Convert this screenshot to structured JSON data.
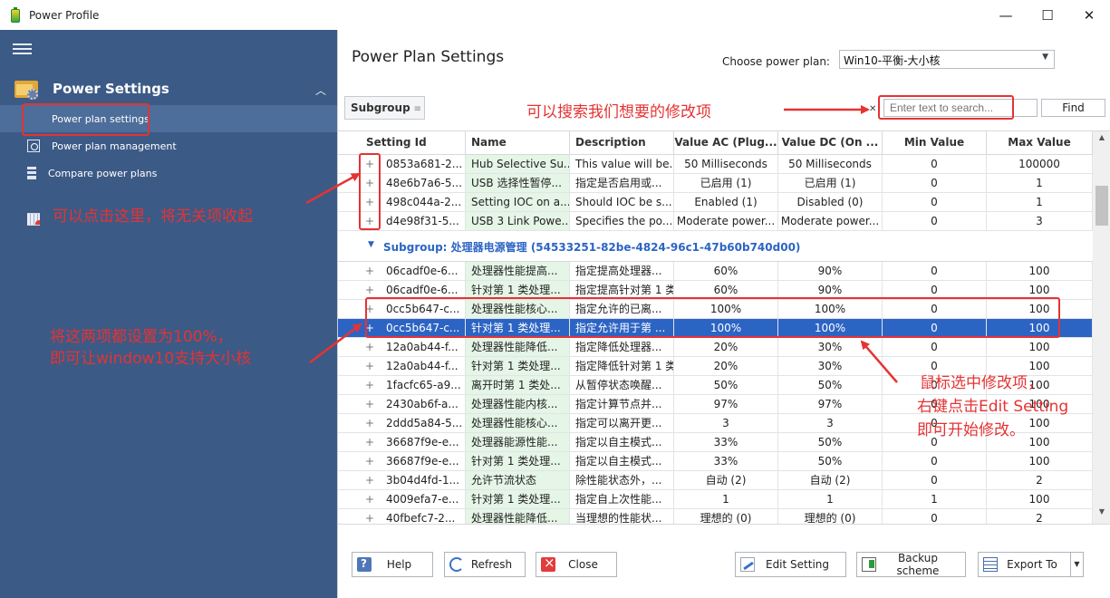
{
  "window": {
    "title": "Power Profile",
    "controls": {
      "minimize": "—",
      "maximize": "☐",
      "close": "✕"
    }
  },
  "sidebar": {
    "header": "Power Settings",
    "items": [
      {
        "label": "Power plan settings",
        "icon": "power-plan-settings-icon",
        "active": true
      },
      {
        "label": "Power plan management",
        "icon": "power-plan-management-icon",
        "active": false
      },
      {
        "label": "Compare power plans",
        "icon": "compare-power-plans-icon",
        "active": false
      }
    ]
  },
  "main": {
    "title": "Power Plan Settings",
    "plan_label": "Choose power plan:",
    "plan_value": "Win10-平衡-大小核",
    "subgroup_button": "Subgroup",
    "search_placeholder": "Enter text to search...",
    "find_button": "Find"
  },
  "grid": {
    "columns": [
      "Setting Id",
      "Name",
      "Description",
      "Value AC (Plug...",
      "Value DC (On ...",
      "Min Value",
      "Max Value"
    ],
    "group1_rows": [
      {
        "expander": "+",
        "id": "0853a681-2...",
        "name": "Hub Selective Su...",
        "desc": "This value will be...",
        "ac": "50 Milliseconds",
        "dc": "50 Milliseconds",
        "min": "0",
        "max": "100000"
      },
      {
        "expander": "+",
        "id": "48e6b7a6-5...",
        "name": "USB 选择性暂停...",
        "desc": "指定是否启用或...",
        "ac": "已启用 (1)",
        "dc": "已启用 (1)",
        "min": "0",
        "max": "1"
      },
      {
        "expander": "+",
        "id": "498c044a-2...",
        "name": "Setting IOC on a...",
        "desc": "Should IOC be s...",
        "ac": "Enabled (1)",
        "dc": "Disabled (0)",
        "min": "0",
        "max": "1"
      },
      {
        "expander": "+",
        "id": "d4e98f31-5...",
        "name": "USB 3 Link Powe...",
        "desc": "Specifies the po...",
        "ac": "Moderate power...",
        "dc": "Moderate power...",
        "min": "0",
        "max": "3"
      }
    ],
    "subgroup_label": "Subgroup: 处理器电源管理 (54533251-82be-4824-96c1-47b60b740d00)",
    "group2_rows": [
      {
        "expander": "+",
        "id": "06cadf0e-6...",
        "name": "处理器性能提高...",
        "desc": "指定提高处理器...",
        "ac": "60%",
        "dc": "90%",
        "min": "0",
        "max": "100"
      },
      {
        "expander": "+",
        "id": "06cadf0e-6...",
        "name": "针对第 1 类处理...",
        "desc": "指定提高针对第 1 类...",
        "ac": "60%",
        "dc": "90%",
        "min": "0",
        "max": "100"
      },
      {
        "expander": "+",
        "id": "0cc5b647-c...",
        "name": "处理器性能核心...",
        "desc": "指定允许的已离...",
        "ac": "100%",
        "dc": "100%",
        "min": "0",
        "max": "100"
      },
      {
        "expander": "+",
        "id": "0cc5b647-c...",
        "name": "针对第 1 类处理...",
        "desc": "指定允许用于第 ...",
        "ac": "100%",
        "dc": "100%",
        "min": "0",
        "max": "100",
        "selected": true
      },
      {
        "expander": "+",
        "id": "12a0ab44-f...",
        "name": "处理器性能降低...",
        "desc": "指定降低处理器...",
        "ac": "20%",
        "dc": "30%",
        "min": "0",
        "max": "100"
      },
      {
        "expander": "+",
        "id": "12a0ab44-f...",
        "name": "针对第 1 类处理...",
        "desc": "指定降低针对第 1 类...",
        "ac": "20%",
        "dc": "30%",
        "min": "0",
        "max": "100"
      },
      {
        "expander": "+",
        "id": "1facfc65-a9...",
        "name": "离开时第 1 类处...",
        "desc": "从暂停状态唤醒...",
        "ac": "50%",
        "dc": "50%",
        "min": "0",
        "max": "100"
      },
      {
        "expander": "+",
        "id": "2430ab6f-a...",
        "name": "处理器性能内核...",
        "desc": "指定计算节点并...",
        "ac": "97%",
        "dc": "97%",
        "min": "0",
        "max": "100"
      },
      {
        "expander": "+",
        "id": "2ddd5a84-5...",
        "name": "处理器性能核心...",
        "desc": "指定可以离开更...",
        "ac": "3",
        "dc": "3",
        "min": "0",
        "max": "100"
      },
      {
        "expander": "+",
        "id": "36687f9e-e...",
        "name": "处理器能源性能...",
        "desc": "指定以自主模式...",
        "ac": "33%",
        "dc": "50%",
        "min": "0",
        "max": "100"
      },
      {
        "expander": "+",
        "id": "36687f9e-e...",
        "name": "针对第 1 类处理...",
        "desc": "指定以自主模式...",
        "ac": "33%",
        "dc": "50%",
        "min": "0",
        "max": "100"
      },
      {
        "expander": "+",
        "id": "3b04d4fd-1...",
        "name": "允许节流状态",
        "desc": "除性能状态外，...",
        "ac": "自动 (2)",
        "dc": "自动 (2)",
        "min": "0",
        "max": "2"
      },
      {
        "expander": "+",
        "id": "4009efa7-e...",
        "name": "针对第 1 类处理...",
        "desc": "指定自上次性能...",
        "ac": "1",
        "dc": "1",
        "min": "1",
        "max": "100"
      },
      {
        "expander": "+",
        "id": "40fbefc7-2...",
        "name": "处理器性能降低...",
        "desc": "当理想的性能状...",
        "ac": "理想的 (0)",
        "dc": "理想的 (0)",
        "min": "0",
        "max": "2"
      }
    ]
  },
  "buttons": {
    "help": "Help",
    "refresh": "Refresh",
    "close": "Close",
    "edit_setting": "Edit Setting",
    "backup_scheme": "Backup scheme",
    "export_to": "Export To"
  },
  "annotations": {
    "search_hint": "可以搜索我们想要的修改项",
    "collapse_hint": "可以点击这里，将无关项收起",
    "set100_line1": "将这两项都设置为100%，",
    "set100_line2": "即可让window10支持大小核",
    "edit_line1": "鼠标选中修改项，",
    "edit_line2": "右键点击Edit Setting",
    "edit_line3": "即可开始修改。"
  },
  "colors": {
    "sidebar_bg": "#3c5a86",
    "selected_row": "#2c64c4",
    "name_cell_bg": "#e5f5e6",
    "annotation_red": "#e53333"
  }
}
